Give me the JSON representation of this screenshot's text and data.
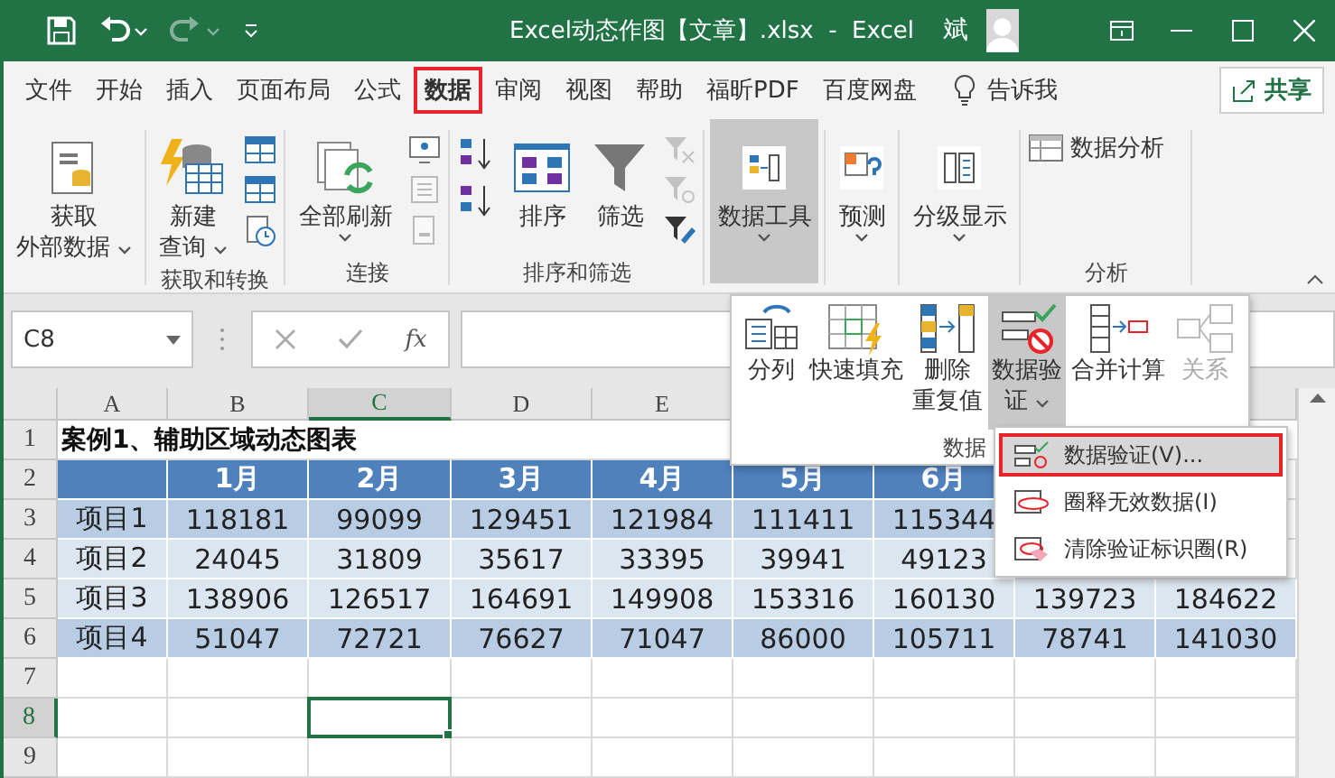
{
  "title_bar": {
    "title": "Excel动态作图【文章】.xlsx  -  Excel",
    "user": "斌",
    "redo": {
      "disabled": true
    }
  },
  "menu": {
    "tabs": [
      {
        "label": "文件",
        "selected": false,
        "highlighted": false
      },
      {
        "label": "开始",
        "selected": false,
        "highlighted": false
      },
      {
        "label": "插入",
        "selected": false,
        "highlighted": false
      },
      {
        "label": "页面布局",
        "selected": false,
        "highlighted": false
      },
      {
        "label": "公式",
        "selected": false,
        "highlighted": false
      },
      {
        "label": "数据",
        "selected": true,
        "highlighted": true
      },
      {
        "label": "审阅",
        "selected": false,
        "highlighted": false
      },
      {
        "label": "视图",
        "selected": false,
        "highlighted": false
      },
      {
        "label": "帮助",
        "selected": false,
        "highlighted": false
      },
      {
        "label": "福昕PDF",
        "selected": false,
        "highlighted": false
      },
      {
        "label": "百度网盘",
        "selected": false,
        "highlighted": false
      }
    ],
    "tell_me": "告诉我",
    "share": "共享"
  },
  "ribbon": {
    "groups": [
      {
        "items": [
          {
            "kind": "large",
            "lines": [
              "获取",
              "外部数据"
            ],
            "caret": true,
            "pressed": false,
            "disabled": false
          }
        ]
      },
      {
        "label": "获取和转换",
        "items": [
          {
            "kind": "large",
            "lines": [
              "新建",
              "查询"
            ],
            "caret": true,
            "pressed": false,
            "disabled": false
          },
          {
            "kind": "stack",
            "buttons": [
              {
                "disabled": false
              },
              {
                "disabled": false
              },
              {
                "disabled": false
              }
            ]
          }
        ]
      },
      {
        "label": "连接",
        "items": [
          {
            "kind": "large",
            "lines": [
              "全部刷新"
            ],
            "caret": true,
            "pressed": false,
            "disabled": false
          },
          {
            "kind": "stack",
            "buttons": [
              {
                "disabled": false
              },
              {
                "disabled": true
              },
              {
                "disabled": true
              }
            ]
          }
        ]
      },
      {
        "label": "排序和筛选",
        "items": [
          {
            "kind": "stack",
            "buttons": [
              {
                "disabled": false
              },
              {
                "disabled": false
              }
            ]
          },
          {
            "kind": "large",
            "lines": [
              "排序"
            ],
            "caret": false,
            "pressed": false,
            "disabled": false
          },
          {
            "kind": "large",
            "lines": [
              "筛选"
            ],
            "caret": false,
            "pressed": false,
            "disabled": false
          },
          {
            "kind": "stack",
            "buttons": [
              {
                "disabled": true
              },
              {
                "disabled": true
              },
              {
                "disabled": false
              }
            ]
          }
        ]
      },
      {
        "items": [
          {
            "kind": "large",
            "lines": [
              "数据工具"
            ],
            "caret": true,
            "pressed": true,
            "disabled": false
          }
        ]
      },
      {
        "items": [
          {
            "kind": "large",
            "lines": [
              "预测"
            ],
            "caret": true,
            "pressed": false,
            "disabled": false
          }
        ]
      },
      {
        "items": [
          {
            "kind": "large",
            "lines": [
              "分级显示"
            ],
            "caret": true,
            "pressed": false,
            "disabled": false
          }
        ]
      },
      {
        "label": "分析",
        "items": [
          {
            "kind": "small",
            "label": "数据分析",
            "disabled": false
          }
        ]
      }
    ]
  },
  "formula_bar": {
    "name_box": "C8",
    "function_label": "fx"
  },
  "sheet": {
    "columns": [
      {
        "label": "A",
        "selected": false
      },
      {
        "label": "B",
        "selected": false
      },
      {
        "label": "C",
        "selected": true
      },
      {
        "label": "D",
        "selected": false
      },
      {
        "label": "E",
        "selected": false
      }
    ],
    "rows": [
      {
        "header": "1",
        "selected": false,
        "kind": "title",
        "cells": [
          "案例1、辅助区域动态图表"
        ]
      },
      {
        "header": "2",
        "selected": false,
        "kind": "header",
        "cells": [
          "",
          "1月",
          "2月",
          "3月",
          "4月",
          "5月",
          "6月"
        ]
      },
      {
        "header": "3",
        "selected": false,
        "kind": "band_dark",
        "cells": [
          "项目1",
          "118181",
          "99099",
          "129451",
          "121984",
          "111411",
          "115344"
        ]
      },
      {
        "header": "4",
        "selected": false,
        "kind": "band_light",
        "cells": [
          "项目2",
          "24045",
          "31809",
          "35617",
          "33395",
          "39941",
          "49123"
        ]
      },
      {
        "header": "5",
        "selected": false,
        "kind": "band_light",
        "cells": [
          "项目3",
          "138906",
          "126517",
          "164691",
          "149908",
          "153316",
          "160130",
          "139723",
          "184622"
        ]
      },
      {
        "header": "6",
        "selected": false,
        "kind": "band_dark",
        "cells": [
          "项目4",
          "51047",
          "72721",
          "76627",
          "71047",
          "86000",
          "105711",
          "78741",
          "141030"
        ]
      },
      {
        "header": "7",
        "selected": false,
        "kind": "empty",
        "cells": []
      },
      {
        "header": "8",
        "selected": true,
        "kind": "empty",
        "cells": []
      },
      {
        "header": "9",
        "selected": false,
        "kind": "empty",
        "cells": []
      }
    ]
  },
  "data_tools_panel": {
    "group_label": "数据",
    "buttons": [
      {
        "lines": [
          "分列"
        ],
        "caret": false,
        "pressed": false,
        "disabled": false
      },
      {
        "lines": [
          "快速填充"
        ],
        "caret": false,
        "pressed": false,
        "disabled": false
      },
      {
        "lines": [
          "删除",
          "重复值"
        ],
        "caret": false,
        "pressed": false,
        "disabled": false
      },
      {
        "lines": [
          "数据验",
          "证"
        ],
        "caret": true,
        "pressed": true,
        "disabled": false
      },
      {
        "lines": [
          "合并计算"
        ],
        "caret": false,
        "pressed": false,
        "disabled": false
      },
      {
        "lines": [
          "关系"
        ],
        "caret": false,
        "pressed": false,
        "disabled": true
      }
    ]
  },
  "validation_menu": {
    "items": [
      {
        "label": "数据验证(V)...",
        "selected": true,
        "highlighted": true
      },
      {
        "label": "圈释无效数据(I)",
        "selected": false,
        "highlighted": false
      },
      {
        "label": "清除验证标识圈(R)",
        "selected": false,
        "highlighted": false
      }
    ]
  }
}
